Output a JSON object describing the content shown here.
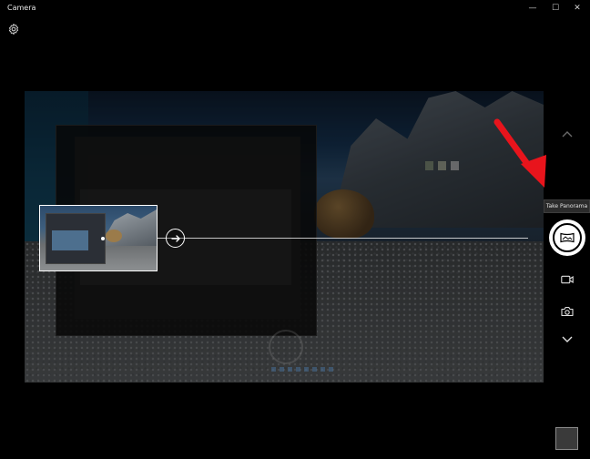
{
  "window": {
    "title": "Camera",
    "controls": {
      "minimize": "—",
      "maximize": "☐",
      "close": "✕"
    }
  },
  "toolbar": {
    "settings_icon": "gear-icon"
  },
  "side_controls": {
    "up_icon": "chevron-up-icon",
    "tooltip": "Take Panorama",
    "shutter_icon": "panorama-icon",
    "video_icon": "video-camera-icon",
    "photo_icon": "camera-icon",
    "down_icon": "chevron-down-icon"
  },
  "panorama": {
    "direction_icon": "arrow-right-icon"
  },
  "annotation": {
    "arrow_color": "#e8141c"
  },
  "colors": {
    "background": "#000000",
    "accent": "#ffffff"
  }
}
